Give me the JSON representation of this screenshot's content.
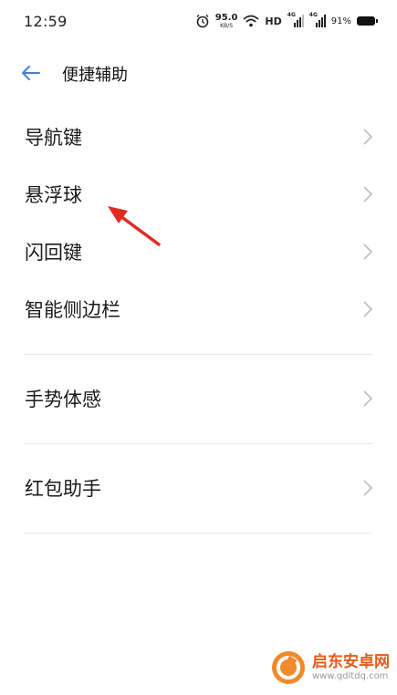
{
  "status_bar": {
    "time": "12:59",
    "net_speed_value": "95.0",
    "net_speed_unit": "KB/S",
    "hd_label": "HD",
    "sim1_label": "4G",
    "sim2_label": "4G",
    "battery_text": "91%"
  },
  "header": {
    "title": "便捷辅助"
  },
  "menu": {
    "group1": [
      {
        "label": "导航键"
      },
      {
        "label": "悬浮球"
      },
      {
        "label": "闪回键"
      },
      {
        "label": "智能侧边栏"
      }
    ],
    "group2": [
      {
        "label": "手势体感"
      }
    ],
    "group3": [
      {
        "label": "红包助手"
      }
    ]
  },
  "watermark": {
    "name": "启东安卓网",
    "url": "www.qdltdq.com"
  },
  "colors": {
    "accent_back": "#4a7ecf",
    "annotation_arrow": "#e32a22",
    "watermark_orange": "#e55a1c"
  },
  "icons": [
    "alarm-icon",
    "wifi-icon",
    "signal-icon",
    "battery-icon",
    "back-arrow-icon",
    "chevron-right-icon"
  ]
}
